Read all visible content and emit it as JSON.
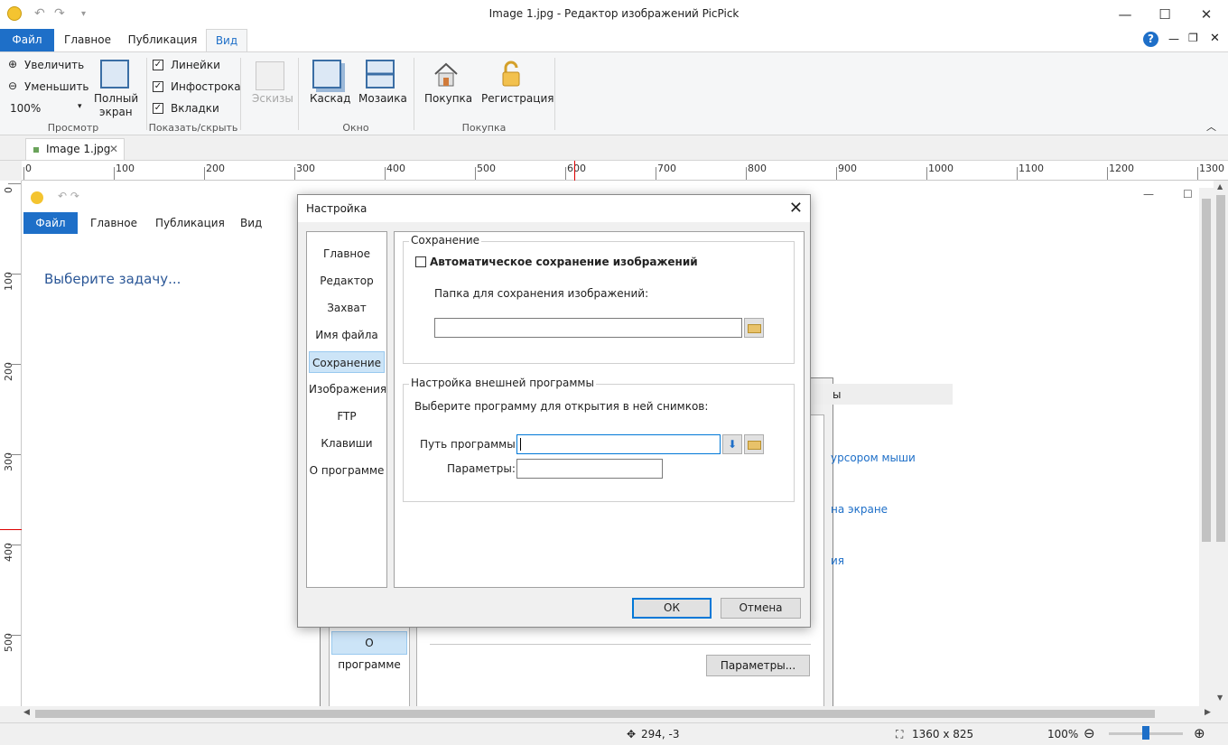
{
  "window": {
    "title": "Image 1.jpg - Редактор изображений PicPick"
  },
  "ribbon_tabs": [
    "Файл",
    "Главное",
    "Публикация",
    "Вид"
  ],
  "ribbon": {
    "zoom_in": "Увеличить",
    "zoom_out": "Уменьшить",
    "zoom_level": "100%",
    "fullscreen_line1": "Полный",
    "fullscreen_line2": "экран",
    "group_view": "Просмотр",
    "rulers": "Линейки",
    "infobar": "Инфострока",
    "tabs": "Вкладки",
    "group_showhide": "Показать/скрыть",
    "thumbs": "Эскизы",
    "cascade": "Каскад",
    "tile": "Мозаика",
    "group_window": "Окно",
    "buy": "Покупка",
    "register": "Регистрация",
    "group_purchase": "Покупка"
  },
  "doc_tab": {
    "label": "Image 1.jpg",
    "close": "✕"
  },
  "ruler_h": [
    "0",
    "100",
    "200",
    "300",
    "400",
    "500",
    "600",
    "700",
    "800",
    "900",
    "1000",
    "1100",
    "1200",
    "1300"
  ],
  "ruler_v": [
    "0",
    "100",
    "200",
    "300",
    "400",
    "500"
  ],
  "inner_app": {
    "tabs": [
      "Файл",
      "Главное",
      "Публикация",
      "Вид"
    ],
    "task_prompt": "Выберите задачу...",
    "link_1": "урсором мыши",
    "link_2": "на экране",
    "link_3": "ия",
    "bg_dialog_title_tail": "ы",
    "bg_about": "О программе",
    "bg_params_button": "Параметры..."
  },
  "dialog": {
    "title": "Настройка",
    "close": "✕",
    "nav": [
      "Главное",
      "Редактор",
      "Захват",
      "Имя файла",
      "Сохранение",
      "Изображения",
      "FTP",
      "Клавиши",
      "О программе"
    ],
    "selected_nav": "Сохранение",
    "save_group": "Сохранение",
    "auto_save": "Автоматическое сохранение изображений",
    "folder_label": "Папка для сохранения изображений:",
    "folder_value": "",
    "ext_group": "Настройка внешней программы",
    "ext_hint": "Выберите программу для открытия в ней снимков:",
    "path_label": "Путь программы:",
    "path_value": "",
    "params_label": "Параметры:",
    "params_value": "",
    "ok": "ОК",
    "cancel": "Отмена"
  },
  "status": {
    "cursor": "294, -3",
    "size": "1360 x 825",
    "zoom": "100%"
  },
  "colors": {
    "accent": "#1e6fc8",
    "selection": "#cce4f7",
    "link": "#1e6fc8"
  }
}
